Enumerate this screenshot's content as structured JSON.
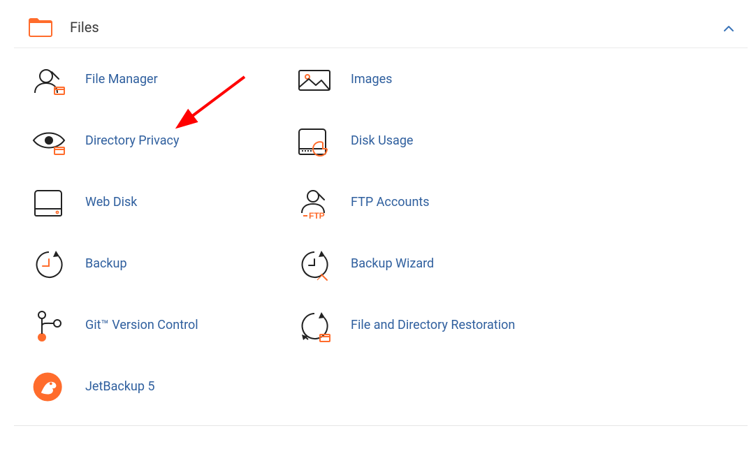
{
  "panel": {
    "title": "Files",
    "items": [
      {
        "label": "File Manager"
      },
      {
        "label": "Images"
      },
      {
        "label": "Directory Privacy"
      },
      {
        "label": "Disk Usage"
      },
      {
        "label": "Web Disk"
      },
      {
        "label": "FTP Accounts"
      },
      {
        "label": "Backup"
      },
      {
        "label": "Backup Wizard"
      },
      {
        "label": "Git™ Version Control"
      },
      {
        "label": "File and Directory Restoration"
      },
      {
        "label": "JetBackup 5"
      }
    ]
  },
  "colors": {
    "link": "#2f5f9e",
    "accent": "#ff6c2c",
    "stroke": "#222"
  }
}
